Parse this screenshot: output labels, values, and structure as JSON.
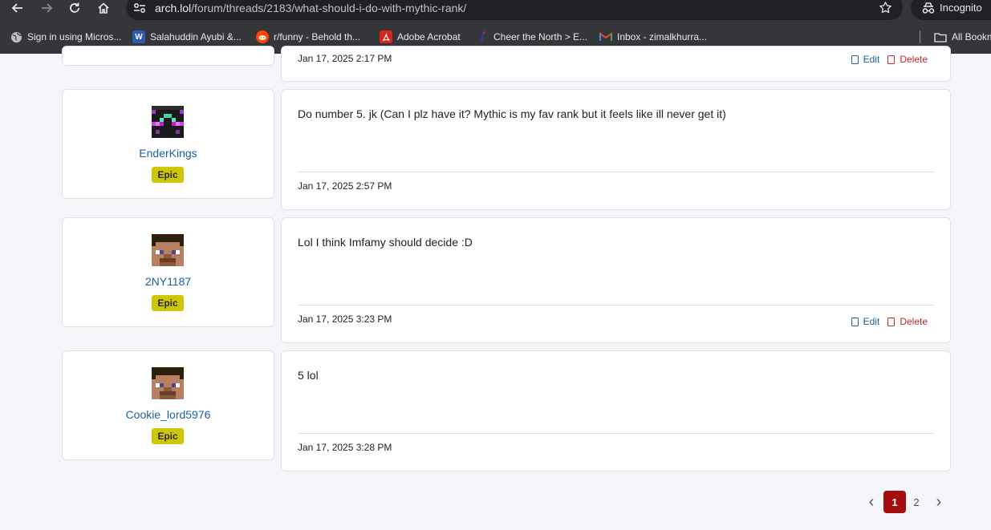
{
  "browser": {
    "url_host": "arch.lol",
    "url_path": "/forum/threads/2183/what-should-i-do-with-mythic-rank/",
    "incognito_label": "Incognito",
    "bookmarks": [
      {
        "label": "Sign in using Micros...",
        "icon": "globe-icon",
        "color": "#8ab4f8"
      },
      {
        "label": "Salahuddin Ayubi &...",
        "icon": "word-icon",
        "color": "#2b5bb5"
      },
      {
        "label": "r/funny - Behold th...",
        "icon": "reddit-icon",
        "color": "#ff4500"
      },
      {
        "label": "Adobe Acrobat",
        "icon": "acrobat-icon",
        "color": "#d7261f"
      },
      {
        "label": "Cheer the North > E...",
        "icon": "cheer-icon",
        "color": "#2b3d91"
      },
      {
        "label": "Inbox - zimalkhurra...",
        "icon": "gmail-icon",
        "color": "#ea4335"
      }
    ],
    "all_bookmarks_label": "All Bookm"
  },
  "partial_post": {
    "timestamp": "Jan 17, 2025 2:17 PM",
    "edit_label": "Edit",
    "delete_label": "Delete"
  },
  "posts": [
    {
      "username": "EnderKings",
      "rank": "Epic",
      "avatar": "enderman-avatar",
      "content": "Do number 5. jk (Can I plz have it? Mythic is my fav rank but it feels like ill never get it)",
      "timestamp": "Jan 17, 2025 2:57 PM"
    },
    {
      "username": "2NY1187",
      "rank": "Epic",
      "avatar": "steve-avatar",
      "content": "Lol I think Imfamy should decide :D",
      "timestamp": "Jan 17, 2025 3:23 PM",
      "edit_label": "Edit",
      "delete_label": "Delete"
    },
    {
      "username": "Cookie_lord5976",
      "rank": "Epic",
      "avatar": "steve-avatar",
      "content": "5 lol",
      "timestamp": "Jan 17, 2025 3:28 PM"
    }
  ],
  "pagination": {
    "prev": "‹",
    "pages": [
      "1",
      "2"
    ],
    "current": "1",
    "next": "›"
  },
  "colors": {
    "accent": "#a50e0e",
    "link": "#1d5f9a",
    "rank_badge": "#cfc607",
    "delete": "#c0282b"
  }
}
